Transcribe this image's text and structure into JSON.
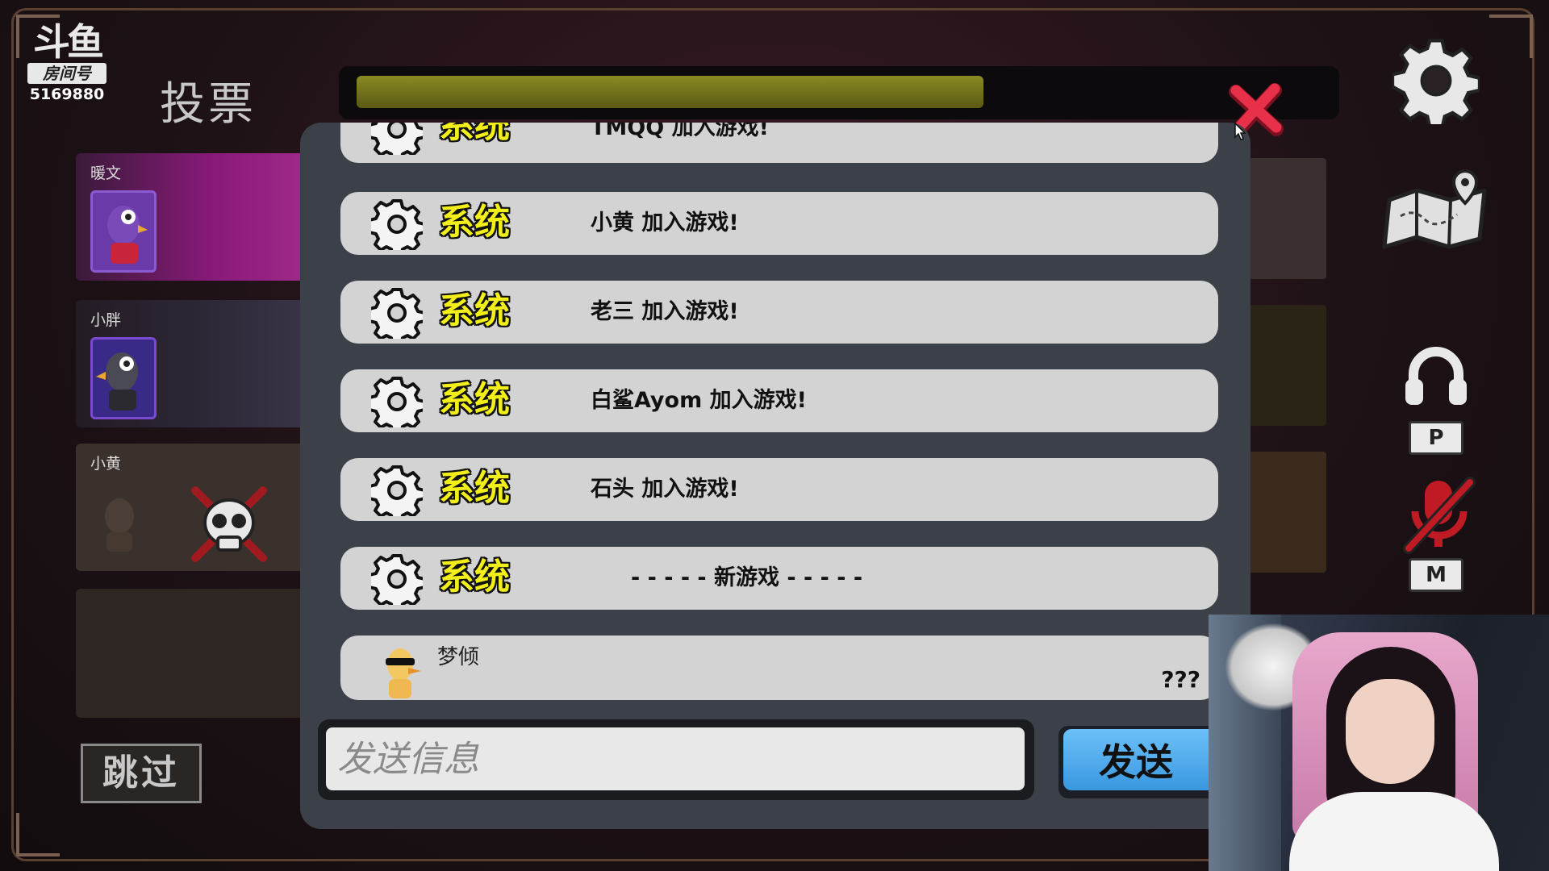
{
  "logo": {
    "mark": "斗鱼",
    "badge": "房间号",
    "room": "5169880"
  },
  "vote_title": "投票",
  "timer": {
    "progress": 0.65
  },
  "players": [
    {
      "name": "暖文",
      "status": "alive"
    },
    {
      "name": "小胖",
      "status": "alive"
    },
    {
      "name": "小黄",
      "status": "dead"
    }
  ],
  "skip_label": "跳过",
  "chat": {
    "system_messages": [
      {
        "source": "系统",
        "text": "TMQQ 加入游戏!"
      },
      {
        "source": "系统",
        "text": "小黄 加入游戏!"
      },
      {
        "source": "系统",
        "text": "老三 加入游戏!"
      },
      {
        "source": "系统",
        "text": "白鲨Ayom 加入游戏!"
      },
      {
        "source": "系统",
        "text": "石头 加入游戏!"
      },
      {
        "source": "系统",
        "text": "- - - - - 新游戏 - - - - -"
      }
    ],
    "user_message": {
      "name": "梦倾",
      "text": "???"
    },
    "input_placeholder": "发送信息",
    "send_label": "发送"
  },
  "hotkeys": {
    "push_to_talk": "P",
    "mute": "M"
  },
  "colors": {
    "system_label": "#f2ee1a",
    "send_button": "#4aa8ec",
    "close": "#e8304a",
    "timer_fill": "#7a7a20"
  },
  "icons": [
    "settings-gear-icon",
    "map-icon",
    "headset-icon",
    "mic-muted-icon",
    "close-icon"
  ]
}
